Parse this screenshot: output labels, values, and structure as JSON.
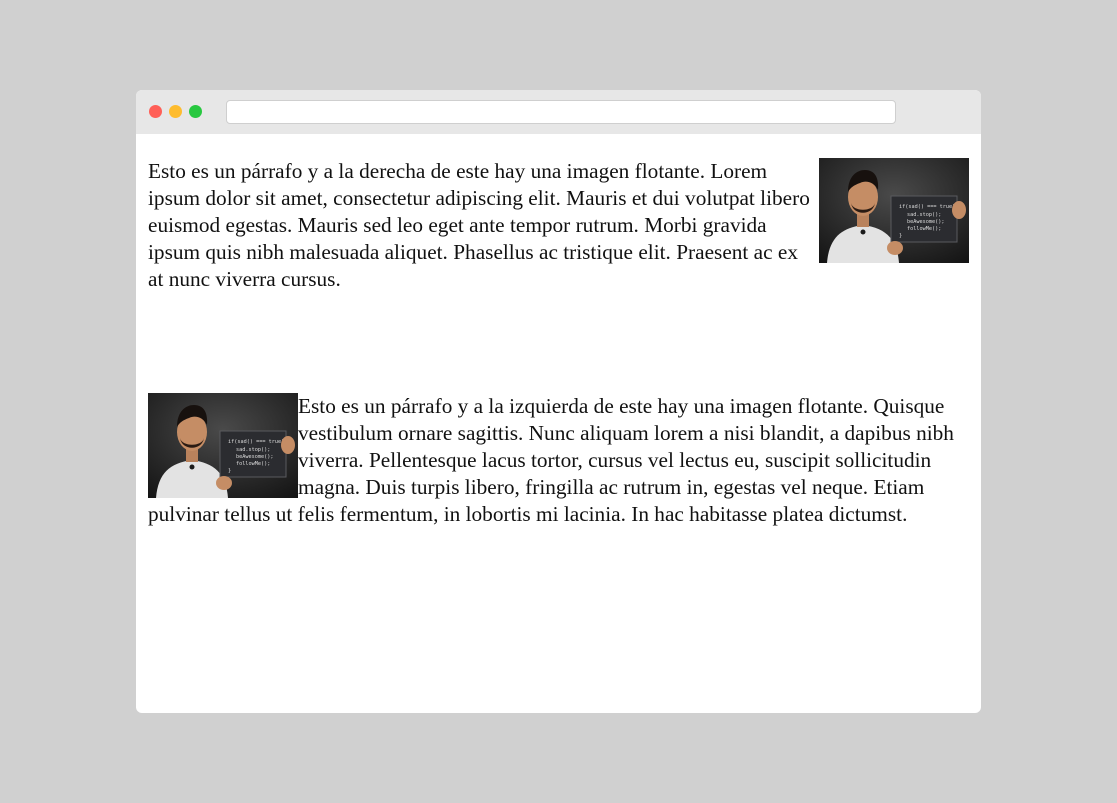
{
  "window": {
    "controls": {
      "close_color": "#ff5f57",
      "minimize_color": "#febc2e",
      "maximize_color": "#28c840"
    },
    "address_bar": {
      "value": ""
    }
  },
  "paragraphs": [
    {
      "text": "Esto es un párrafo y a la derecha de este hay una imagen flotante. Lorem ipsum dolor sit amet, consectetur adipiscing elit. Mauris et dui volutpat libero euismod egestas. Mauris sed leo eget ante tempor rutrum. Morbi gravida ipsum quis nibh malesuada aliquet. Phasellus ac tristique elit. Praesent ac ex at nunc viverra cursus.",
      "image_float": "right"
    },
    {
      "text": "Esto es un párrafo y a la izquierda de este hay una imagen flotante. Quisque vestibulum ornare sagittis. Nunc aliquam lorem a nisi blandit, a dapibus nibh viverra. Pellentesque lacus tortor, cursus vel lectus eu, suscipit sollicitudin magna. Duis turpis libero, fringilla ac rutrum in, egestas vel neque. Etiam pulvinar tellus ut felis fermentum, in lobortis mi lacinia. In hac habitasse platea dictumst.",
      "image_float": "left"
    }
  ],
  "image_board_code": [
    "if(sad() === true) {",
    "sad.stop();",
    "beAwesome();",
    "followMe();",
    "}"
  ],
  "colors": {
    "page_background": "#d0d0d0",
    "window_background": "#ffffff",
    "title_bar": "#e7e7e7",
    "text": "#111111"
  }
}
